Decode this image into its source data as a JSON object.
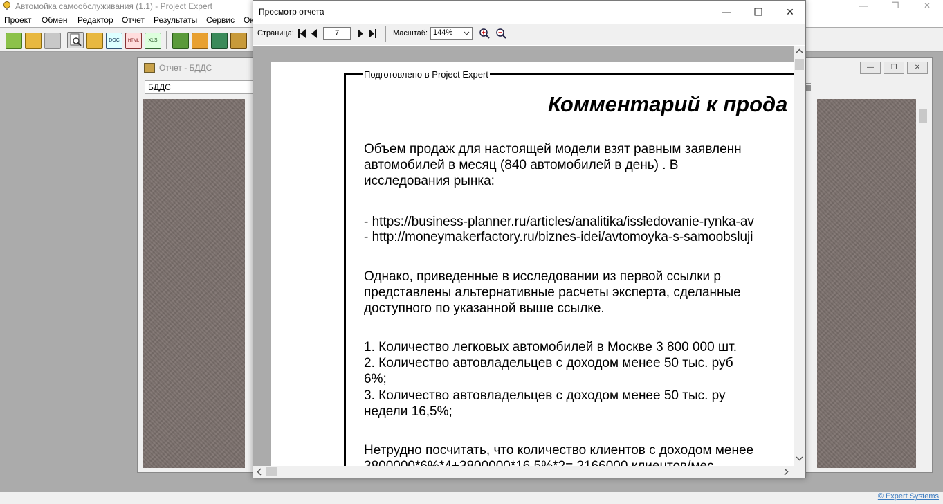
{
  "app": {
    "title": "Автомойка самообслуживания (1.1) - Project Expert",
    "menu": [
      "Проект",
      "Обмен",
      "Редактор",
      "Отчет",
      "Результаты",
      "Сервис",
      "Ок"
    ],
    "controls": {
      "minimize": "—",
      "restore": "❐",
      "close": "✕"
    },
    "toolbar_icons": [
      "new-project-icon",
      "open-folder-icon",
      "save-icon",
      "preview-icon",
      "print-icon",
      "export-doc-icon",
      "export-html-icon",
      "export-xls-icon",
      "tools-icon",
      "edit-icon",
      "calculator-icon",
      "package-icon"
    ],
    "toolbar_labels": {
      "doc": "DOC",
      "html": "HTML",
      "xls": "XLS"
    },
    "copyright": "© Expert Systems"
  },
  "report_window": {
    "title": "Отчет - БДДС",
    "combo_value": "БДДС"
  },
  "preview": {
    "title": "Просмотр отчета",
    "page_label": "Страница:",
    "page_value": "7",
    "zoom_label": "Масштаб:",
    "zoom_value": "144%",
    "frame_label": "Подготовлено в Project Expert",
    "doc_title": "Комментарий к прода",
    "lines": [
      "Объем  продаж для  настоящей модели взят равным заявленн",
      "автомобилей    в   месяц   (840   автомобилей     в   день)   .  В",
      "исследования рынка:",
      "- https://business-planner.ru/articles/analitika/issledovanie-rynka-av",
      "- http://moneymakerfactory.ru/biznes-idei/avtomoyka-s-samoobsluji",
      "Однако,  приведенные  в  исследовании  из  первой  ссылки  р",
      "представлены  альтернативные  расчеты  эксперта,  сделанные",
      "доступного по указанной выше ссылке.",
      "1. Количество легковых автомобилей в Москве   3 800 000 шт.",
      "2.  Количество  автовладельцев  с  доходом  менее  50  тыс.  руб",
      "6%;",
      "3.  Количество  автовладельцев  с  доходом  менее   50  тыс.  ру",
      "недели 16,5%;",
      "Нетрудно посчитать, что количество клиентов с доходом менее",
      "3800000*6%*4+3800000*16,5%*2= 2166000 клиентов/мес"
    ]
  }
}
